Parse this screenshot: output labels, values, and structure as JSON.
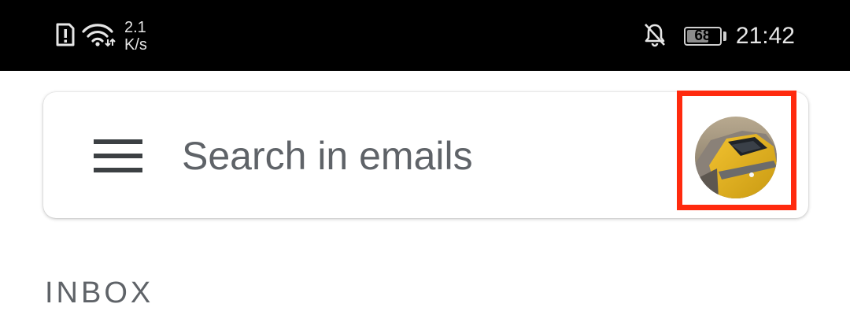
{
  "status_bar": {
    "net_speed_value": "2.1",
    "net_speed_unit": "K/s",
    "battery_level": "68",
    "battery_fraction": 0.68,
    "time": "21:42",
    "icons": [
      "alert-icon",
      "wifi-icon",
      "notifications-off-icon",
      "battery-icon"
    ]
  },
  "search": {
    "placeholder": "Search in emails",
    "menu_icon": "menu-icon",
    "avatar_icon": "account-avatar",
    "highlight_color": "#ff2a0e"
  },
  "mailbox": {
    "label": "INBOX"
  }
}
